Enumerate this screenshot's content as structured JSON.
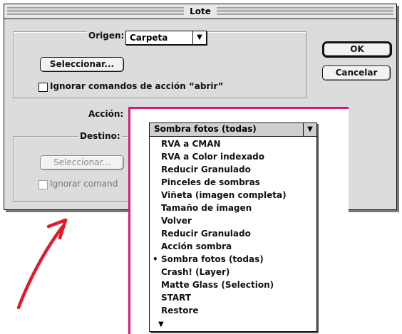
{
  "dialog": {
    "title": "Lote",
    "ok_label": "OK",
    "cancel_label": "Cancelar",
    "origen": {
      "label": "Origen:",
      "value": "Carpeta",
      "select_label": "Seleccionar...",
      "checkbox_label": "Ignorar comandos de acción “abrir”"
    },
    "accion": {
      "label": "Acción:"
    },
    "destino": {
      "label": "Destino:",
      "select_label": "Seleccionar...",
      "checkbox_label": "Ignorar comand"
    }
  },
  "menu": {
    "selected": "Sombra fotos (todas)",
    "items": [
      "RVA a CMAN",
      "RVA a Color indexado",
      "Reducir Granulado",
      "Pinceles de sombras",
      "Viñeta (imagen completa)",
      "Tamaño de imagen",
      "Volver",
      "Reducir Granulado",
      "Acción sombra",
      "Sombra fotos (todas)",
      "Crash! (Layer)",
      "Matte Glass (Selection)",
      "START",
      "Restore"
    ],
    "checked_index": 9
  },
  "colors": {
    "annotation_red": "#e11a2a",
    "frame_magenta": "#d81b7a"
  },
  "icons": [
    "chevron-down-icon",
    "checkbox-icon",
    "more-items-icon",
    "annotation-arrow-icon"
  ]
}
